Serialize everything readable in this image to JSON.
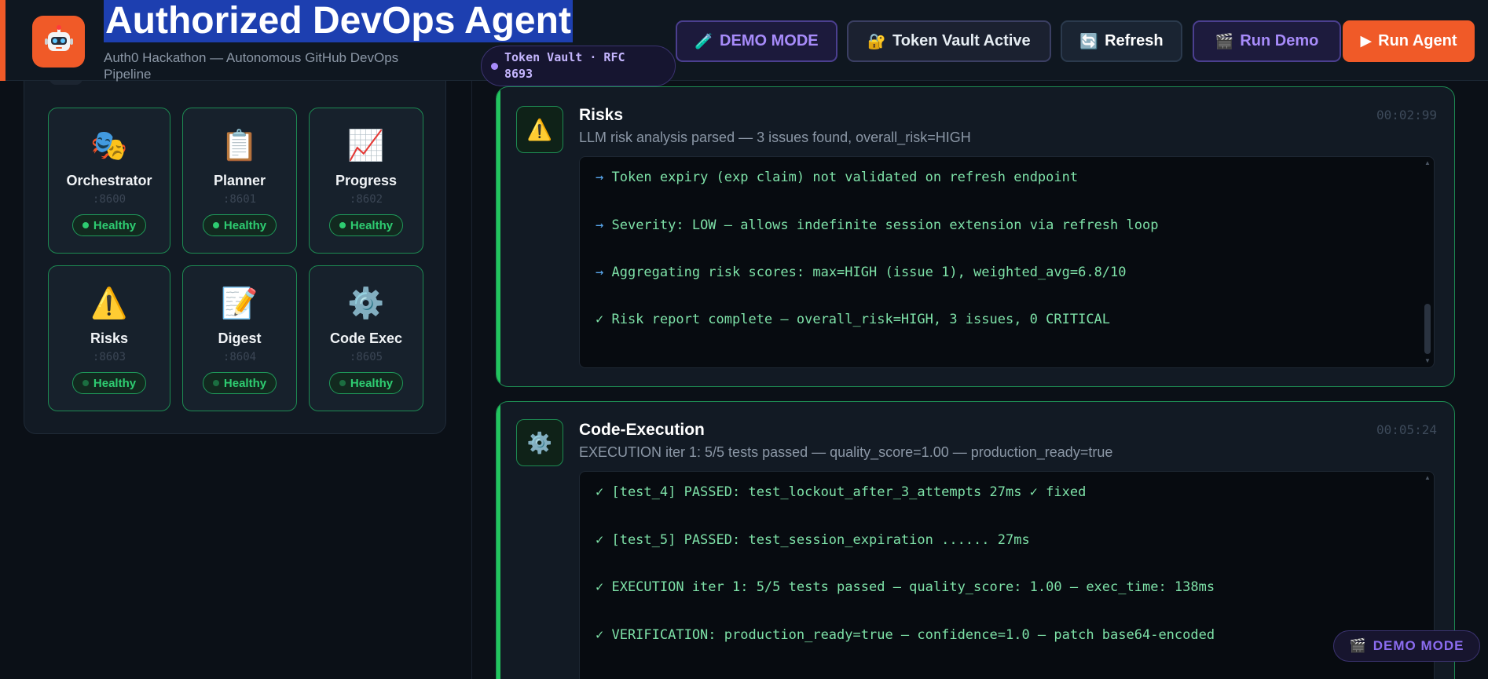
{
  "header": {
    "title": "Authorized DevOps Agent",
    "subtitle": "Auth0 Hackathon — Autonomous GitHub DevOps Pipeline",
    "logo_icon": "robot-icon",
    "vault_pill": "Token Vault · RFC 8693",
    "buttons": {
      "demo_mode": "DEMO MODE",
      "token_vault": "Token Vault Active",
      "refresh": "Refresh",
      "run_demo": "Run Demo",
      "run_agent": "Run Agent"
    }
  },
  "agents": [
    {
      "name": "Orchestrator",
      "port": ":8600",
      "status": "Healthy",
      "icon": "🎭"
    },
    {
      "name": "Planner",
      "port": ":8601",
      "status": "Healthy",
      "icon": "📋"
    },
    {
      "name": "Progress",
      "port": ":8602",
      "status": "Healthy",
      "icon": "📈"
    },
    {
      "name": "Risks",
      "port": ":8603",
      "status": "Healthy",
      "icon": "⚠️"
    },
    {
      "name": "Digest",
      "port": ":8604",
      "status": "Healthy",
      "icon": "📝"
    },
    {
      "name": "Code Exec",
      "port": ":8605",
      "status": "Healthy",
      "icon": "⚙️"
    }
  ],
  "steps": {
    "risks": {
      "title": "Risks",
      "subtitle": "LLM risk analysis parsed — 3 issues found, overall_risk=HIGH",
      "time": "00:02:99",
      "lines": [
        "→ Token expiry (exp claim) not validated on refresh endpoint",
        "→ Severity: LOW — allows indefinite session extension via refresh loop",
        "→ Aggregating risk scores: max=HIGH (issue 1), weighted_avg=6.8/10",
        "✓ Risk report complete — overall_risk=HIGH, 3 issues, 0 CRITICAL"
      ]
    },
    "code_exec": {
      "title": "Code-Execution",
      "subtitle": "EXECUTION iter 1: 5/5 tests passed — quality_score=1.00 — production_ready=true",
      "time": "00:05:24",
      "lines": [
        "✓ [test_4] PASSED: test_lockout_after_3_attempts 27ms ✓ fixed",
        "✓ [test_5] PASSED: test_session_expiration ...... 27ms",
        "✓ EXECUTION iter 1: 5/5 tests passed — quality_score: 1.00 — exec_time: 138ms",
        "✓ VERIFICATION: production_ready=true — confidence=1.0 — patch base64-encoded"
      ]
    }
  },
  "floating_badge": "DEMO MODE",
  "colors": {
    "accent": "#f05a28",
    "success": "#22c55e",
    "purple": "#a78bfa"
  }
}
